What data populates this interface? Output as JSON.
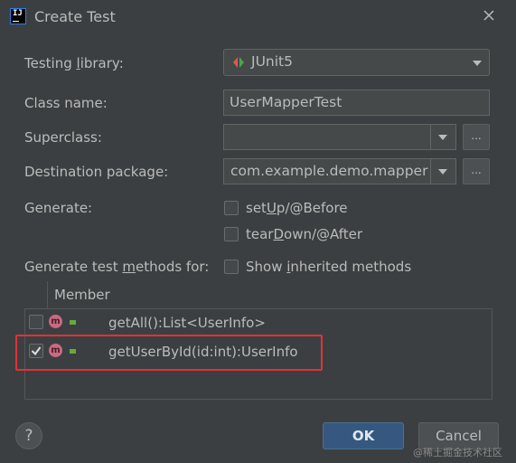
{
  "window": {
    "title": "Create Test",
    "icon": "intellij-icon",
    "close_icon": "close-icon"
  },
  "form": {
    "testing_library": {
      "label": "Testing library:",
      "value": "JUnit5",
      "icon": "junit-icon"
    },
    "class_name": {
      "label": "Class name:",
      "value": "UserMapperTest"
    },
    "superclass": {
      "label": "Superclass:",
      "value": "",
      "browse_label": "..."
    },
    "destination_package": {
      "label": "Destination package:",
      "value": "com.example.demo.mapper",
      "browse_label": "..."
    },
    "generate": {
      "label": "Generate:",
      "options": [
        {
          "label": "setUp/@Before",
          "checked": false
        },
        {
          "label": "tearDown/@After",
          "checked": false
        }
      ]
    },
    "methods_for": {
      "label": "Generate test methods for:",
      "show_inherited_label": "Show inherited methods",
      "show_inherited_checked": false
    }
  },
  "table": {
    "header": "Member",
    "rows": [
      {
        "method": "getAll():List<UserInfo>",
        "checked": false,
        "icon": "method-icon",
        "access_icon": "lock-icon"
      },
      {
        "method": "getUserById(id:int):UserInfo",
        "checked": true,
        "icon": "method-icon",
        "access_icon": "lock-icon"
      }
    ]
  },
  "buttons": {
    "help": "?",
    "ok": "OK",
    "cancel": "Cancel"
  },
  "watermark": "@稀土掘金技术社区",
  "colors": {
    "background": "#3c3f41",
    "field": "#45494a",
    "ok_button": "#365880",
    "highlight": "#e0323a",
    "method_badge": "#c96a83"
  }
}
